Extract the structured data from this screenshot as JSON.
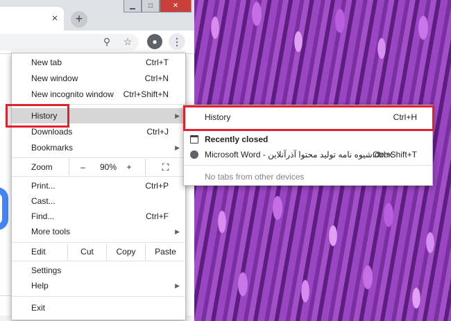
{
  "window": {
    "controls": {
      "minimize": "▁",
      "maximize": "□",
      "close": "✕"
    },
    "tab": {
      "close": "×"
    },
    "new_tab": "+"
  },
  "toolbar": {
    "zoom_icon": "⚲",
    "star_icon": "☆",
    "profile_icon": "●",
    "menu_icon": "⋮"
  },
  "menu": {
    "new_tab": {
      "label": "New tab",
      "shortcut": "Ctrl+T"
    },
    "new_window": {
      "label": "New window",
      "shortcut": "Ctrl+N"
    },
    "new_incognito": {
      "label": "New incognito window",
      "shortcut": "Ctrl+Shift+N"
    },
    "history": {
      "label": "History"
    },
    "downloads": {
      "label": "Downloads",
      "shortcut": "Ctrl+J"
    },
    "bookmarks": {
      "label": "Bookmarks"
    },
    "zoom": {
      "label": "Zoom",
      "minus": "–",
      "value": "90%",
      "plus": "+",
      "fullscreen": "⛶"
    },
    "print": {
      "label": "Print...",
      "shortcut": "Ctrl+P"
    },
    "cast": {
      "label": "Cast..."
    },
    "find": {
      "label": "Find...",
      "shortcut": "Ctrl+F"
    },
    "more_tools": {
      "label": "More tools"
    },
    "edit": {
      "label": "Edit",
      "cut": "Cut",
      "copy": "Copy",
      "paste": "Paste"
    },
    "settings": {
      "label": "Settings"
    },
    "help": {
      "label": "Help"
    },
    "exit": {
      "label": "Exit"
    },
    "arrow": "▶"
  },
  "submenu": {
    "history": {
      "label": "History",
      "shortcut": "Ctrl+H"
    },
    "recently_closed": {
      "label": "Recently closed"
    },
    "recent_item": {
      "label": "Microsoft Word - شیوه نامه تولید محتوا آذرآنلاین.docx",
      "shortcut": "Ctrl+Shift+T"
    },
    "no_tabs": {
      "label": "No tabs from other devices"
    }
  },
  "colors": {
    "highlight_box": "#e0202a",
    "hover": "#d6d6d6",
    "google_blue": "#4285f4"
  }
}
